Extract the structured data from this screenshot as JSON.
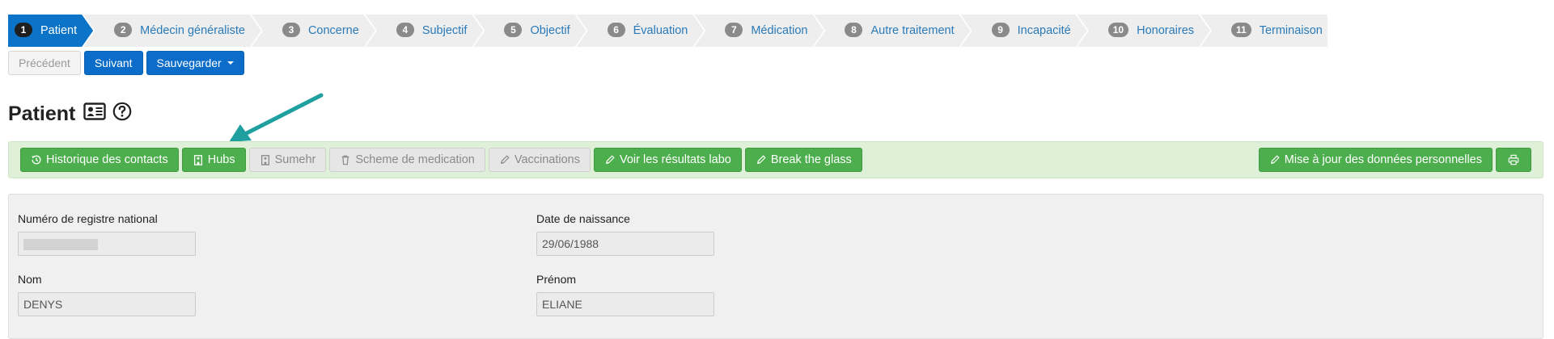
{
  "wizard": {
    "steps": [
      {
        "num": "1",
        "label": "Patient"
      },
      {
        "num": "2",
        "label": "Médecin généraliste"
      },
      {
        "num": "3",
        "label": "Concerne"
      },
      {
        "num": "4",
        "label": "Subjectif"
      },
      {
        "num": "5",
        "label": "Objectif"
      },
      {
        "num": "6",
        "label": "Évaluation"
      },
      {
        "num": "7",
        "label": "Médication"
      },
      {
        "num": "8",
        "label": "Autre traitement"
      },
      {
        "num": "9",
        "label": "Incapacité"
      },
      {
        "num": "10",
        "label": "Honoraires"
      },
      {
        "num": "11",
        "label": "Terminaison"
      }
    ],
    "active_step": 1
  },
  "nav": {
    "previous_label": "Précédent",
    "next_label": "Suivant",
    "save_label": "Sauvegarder"
  },
  "page": {
    "title": "Patient"
  },
  "toolbar": {
    "contact_history_label": "Historique des contacts",
    "hubs_label": "Hubs",
    "sumehr_label": "Sumehr",
    "medication_scheme_label": "Scheme de medication",
    "vaccinations_label": "Vaccinations",
    "lab_results_label": "Voir les résultats labo",
    "break_glass_label": "Break the glass",
    "update_personal_data_label": "Mise à jour des données personnelles"
  },
  "form": {
    "national_register_label": "Numéro de registre national",
    "national_register_value": "",
    "birth_date_label": "Date de naissance",
    "birth_date_value": "29/06/1988",
    "last_name_label": "Nom",
    "last_name_value": "DENYS",
    "first_name_label": "Prénom",
    "first_name_value": "ELIANE"
  },
  "colors": {
    "step_active": "#0b74c8",
    "step_inactive": "#eeeeee",
    "primary": "#0b6cc9",
    "success": "#4cae4c",
    "toolbar_bg": "#dff0d8",
    "annotation_arrow": "#1f9fa0"
  }
}
